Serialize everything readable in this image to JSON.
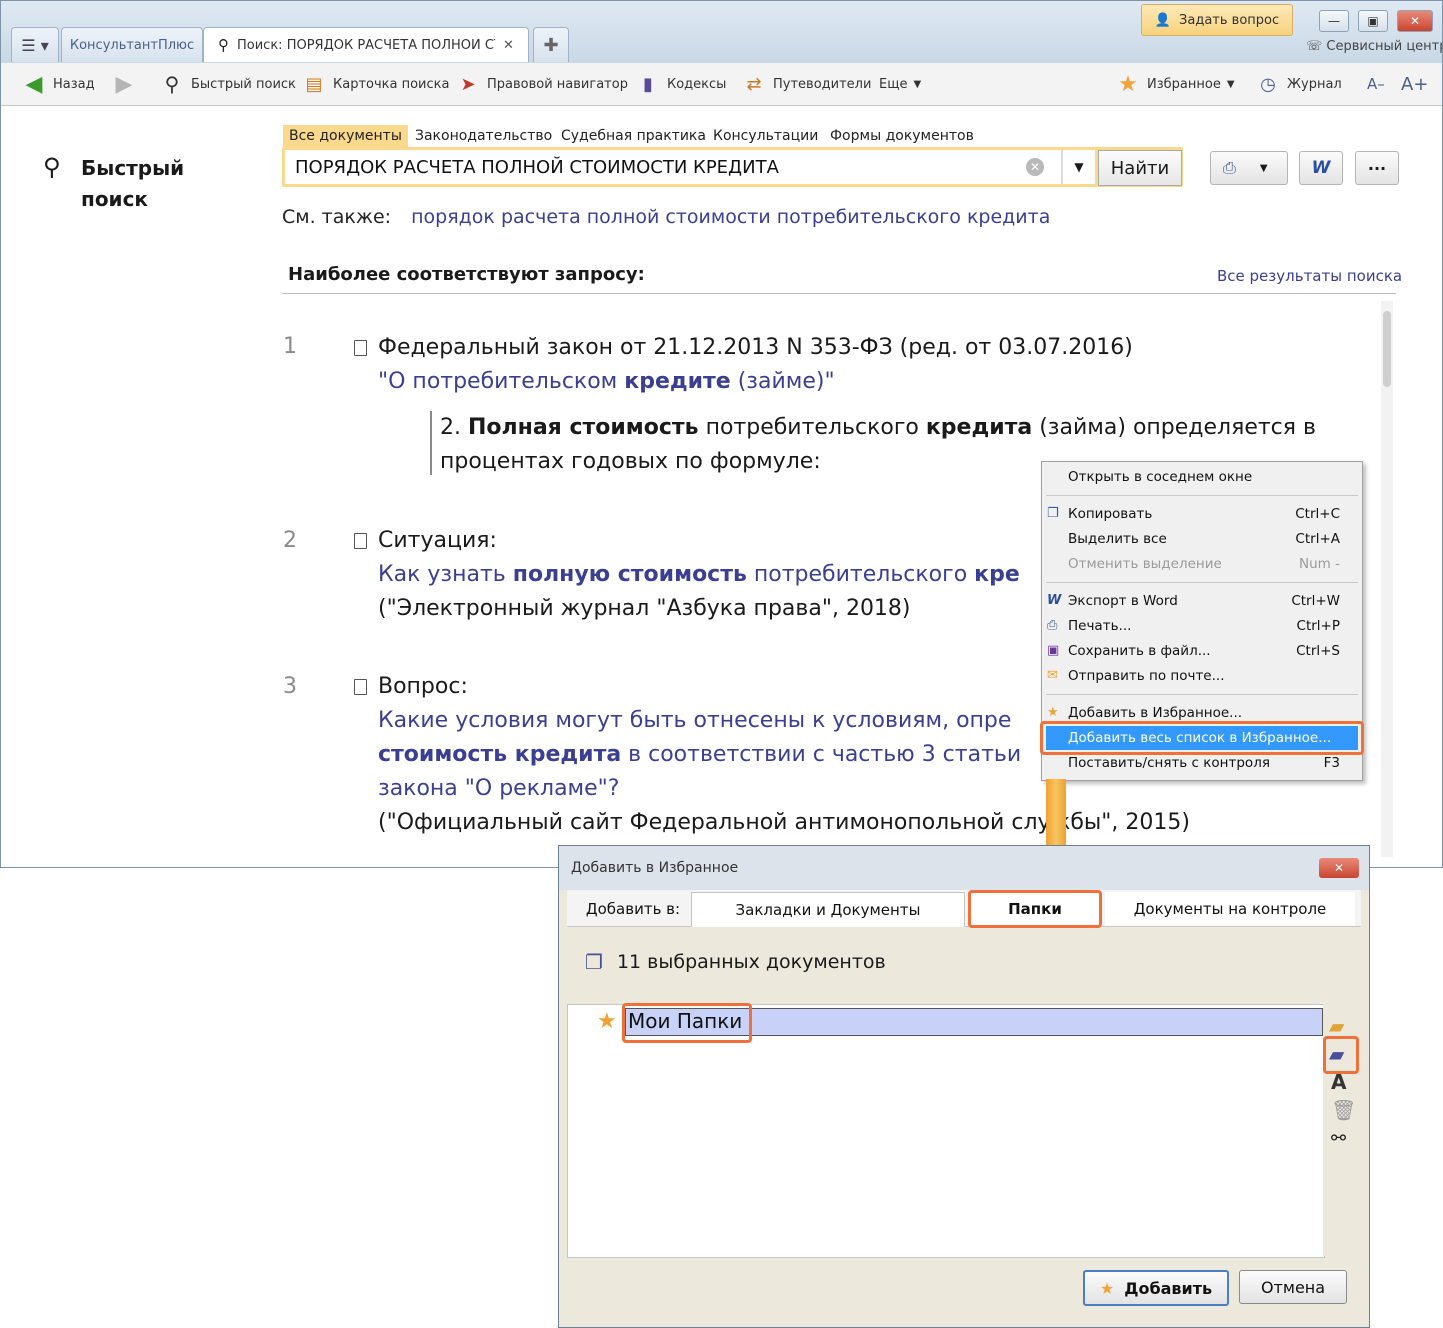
{
  "window": {
    "menu_icon": "hamburger-icon",
    "app_tab": "КонсультантПлюс",
    "search_tab": "Поиск: ПОРЯДОК РАСЧЕТА ПОЛНОЙ СТС",
    "ask_question": "Задать вопрос",
    "service_center": "Сервисный центр"
  },
  "toolbar": {
    "back": "Назад",
    "quick_search": "Быстрый поиск",
    "search_card": "Карточка поиска",
    "legal_navigator": "Правовой навигатор",
    "codes": "Кодексы",
    "guides": "Путеводители",
    "more": "Еще",
    "favorites": "Избранное",
    "journal": "Журнал",
    "font_smaller": "A–",
    "font_bigger": "A+"
  },
  "sidebar": {
    "title_line1": "Быстрый",
    "title_line2": "поиск"
  },
  "filters": [
    "Все документы",
    "Законодательство",
    "Судебная практика",
    "Консультации",
    "Формы документов"
  ],
  "search": {
    "value": "ПОРЯДОК РАСЧЕТА ПОЛНОЙ СТОИМОСТИ КРЕДИТА",
    "find_button": "Найти"
  },
  "see_also": {
    "label": "См. также:",
    "link": "порядок расчета полной стоимости потребительского кредита"
  },
  "results_header": "Наиболее соответствуют запросу:",
  "all_results": "Все результаты поиска",
  "results": [
    {
      "num": "1",
      "line1": "Федеральный закон от 21.12.2013 N 353-ФЗ (ред. от 03.07.2016)",
      "title_a": "\"О потребительском ",
      "title_b": "кредите",
      "title_c": " (займе)\"",
      "snip_a": "2. ",
      "snip_b": "Полная стоимость",
      "snip_c": " потребительского ",
      "snip_d": "кредита",
      "snip_e": " (займа) определяется в",
      "snip_line2": "процентах годовых по формуле:"
    },
    {
      "num": "2",
      "line1": "Ситуация:",
      "title_a": "Как узнать ",
      "title_b": "полную стоимость",
      "title_c": " потребительского ",
      "title_d": "кре",
      "source": "(\"Электронный журнал \"Азбука права\", 2018)"
    },
    {
      "num": "3",
      "line1": "Вопрос:",
      "title_l1": "Какие условия могут быть отнесены к условиям, опре",
      "title_l2b": "стоимость кредита",
      "title_l2c": " в соответствии с частью 3 статьи",
      "title_l3": "закона \"О рекламе\"?",
      "source": "(\"Официальный сайт Федеральной антимонопольной службы\", 2015)"
    }
  ],
  "context_menu": {
    "open_adjacent": "Открыть в соседнем окне",
    "copy": "Копировать",
    "copy_sc": "Ctrl+C",
    "select_all": "Выделить все",
    "select_all_sc": "Ctrl+A",
    "deselect": "Отменить выделение",
    "deselect_sc": "Num -",
    "export_word": "Экспорт в Word",
    "export_word_sc": "Ctrl+W",
    "print": "Печать...",
    "print_sc": "Ctrl+P",
    "save_file": "Сохранить в файл...",
    "save_file_sc": "Ctrl+S",
    "send_mail": "Отправить по почте...",
    "add_fav": "Добавить в Избранное...",
    "add_all_fav": "Добавить весь список в Избранное...",
    "control": "Поставить/снять с контроля",
    "control_sc": "F3"
  },
  "dialog": {
    "title": "Добавить в Избранное",
    "add_to_label": "Добавить в:",
    "tabs": [
      "Закладки и Документы",
      "Папки",
      "Документы на контроле"
    ],
    "selected_docs": "11 выбранных документов",
    "folder_name": "Мои Папки",
    "add_button": "Добавить",
    "cancel_button": "Отмена"
  },
  "colors": {
    "accent": "#f0703a",
    "link": "#3a3f94",
    "selection": "#3399ff",
    "active_filter": "#fbd98c"
  }
}
